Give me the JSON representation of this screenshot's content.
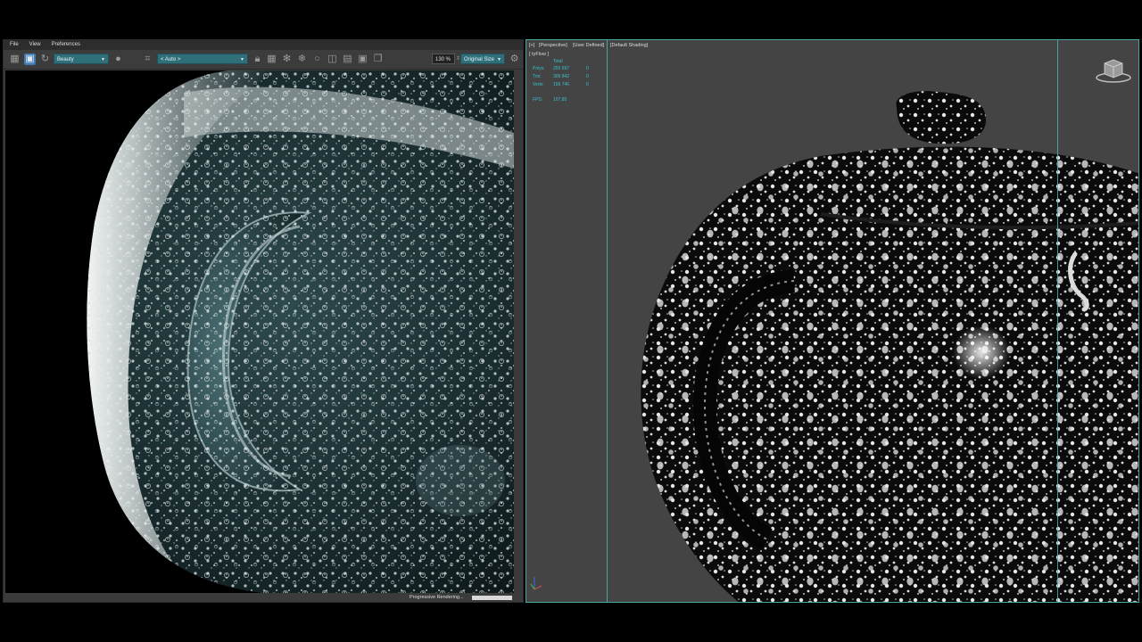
{
  "render_window": {
    "menu": [
      "File",
      "View",
      "Preferences"
    ],
    "render_element": "Beauty",
    "region": "< Auto >",
    "zoom": "130 %",
    "size_mode": "Original Size",
    "status": "Progressive Rendering..."
  },
  "viewport": {
    "labels": {
      "plus": "[+]",
      "view": "[Perspective]",
      "mode": "[User Defined]",
      "shading": "[Default Shading]",
      "object": "[ tyFlow ]"
    },
    "stats": {
      "header": "Total",
      "rows": [
        {
          "label": "Polys:",
          "value": "255 697",
          "sel": "0"
        },
        {
          "label": "Tris:",
          "value": "306 842",
          "sel": "0"
        },
        {
          "label": "Verts:",
          "value": "156 746",
          "sel": "0"
        }
      ],
      "fps_label": "FPS:",
      "fps_value": "107.85"
    }
  },
  "colors": {
    "accent": "#3fa7a4",
    "stats_text": "#37c2cc",
    "toolbar_select": "#2f6f7a"
  },
  "icons": [
    "render-frame-icon",
    "render-active-icon",
    "refresh-icon",
    "teapot-icon",
    "crop-icon",
    "lock-icon",
    "grid-icon",
    "snowflake-icon",
    "sphere-icon",
    "layers-icon",
    "copy-icon",
    "settings-icon",
    "viewcube-icon",
    "axis-tripod-icon"
  ]
}
